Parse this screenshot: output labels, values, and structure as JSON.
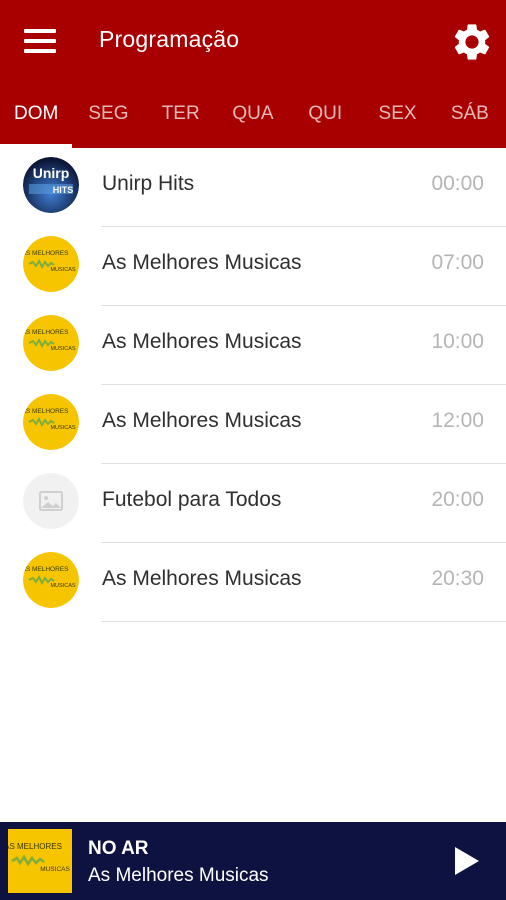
{
  "header": {
    "title": "Programação"
  },
  "tabs": [
    {
      "label": "DOM",
      "active": true
    },
    {
      "label": "SEG"
    },
    {
      "label": "TER"
    },
    {
      "label": "QUA"
    },
    {
      "label": "QUI"
    },
    {
      "label": "SEX"
    },
    {
      "label": "SÁB"
    }
  ],
  "schedule": [
    {
      "title": "Unirp Hits",
      "time": "00:00",
      "thumb": "unirp-hits-logo"
    },
    {
      "title": "As Melhores Musicas",
      "time": "07:00",
      "thumb": "as-melhores-musicas-logo"
    },
    {
      "title": "As Melhores Musicas",
      "time": "10:00",
      "thumb": "as-melhores-musicas-logo"
    },
    {
      "title": "As Melhores Musicas",
      "time": "12:00",
      "thumb": "as-melhores-musicas-logo"
    },
    {
      "title": "Futebol para Todos",
      "time": "20:00",
      "thumb": "image-placeholder-icon"
    },
    {
      "title": "As Melhores Musicas",
      "time": "20:30",
      "thumb": "as-melhores-musicas-logo"
    }
  ],
  "logos": {
    "unirp": {
      "line1": "Unirp",
      "line2": "HITS"
    },
    "melhores": {
      "line1": "AS MELHORES",
      "line2": "MUSICAS"
    }
  },
  "player": {
    "status": "NO AR",
    "track": "As Melhores Musicas"
  },
  "colors": {
    "appbar": "#a80000",
    "player": "#0e1240",
    "logo_yellow": "#f6c500"
  }
}
